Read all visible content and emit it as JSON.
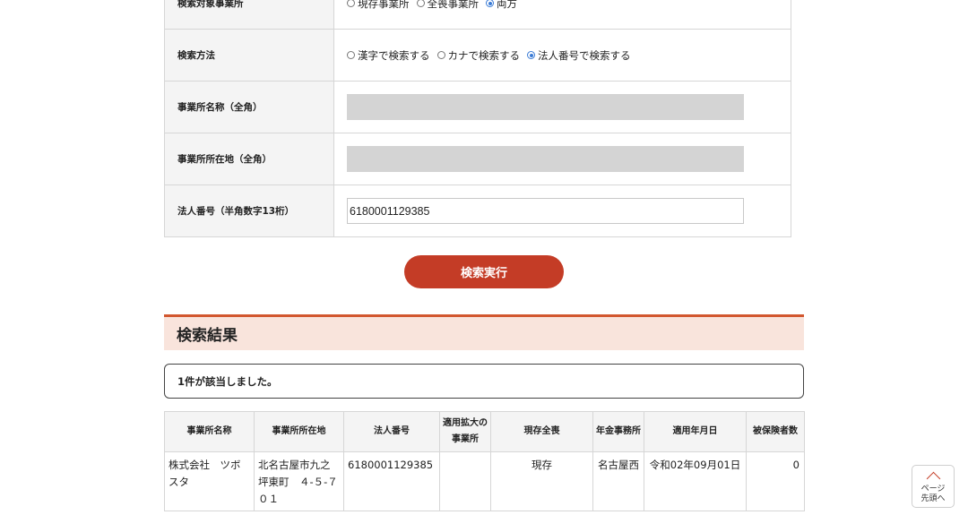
{
  "form": {
    "target": {
      "label": "検索対象事業所",
      "options": [
        "現存事業所",
        "全喪事業所",
        "両方"
      ],
      "selected_index": 2
    },
    "method": {
      "label": "検索方法",
      "options": [
        "漢字で検索する",
        "カナで検索する",
        "法人番号で検索する"
      ],
      "selected_index": 2
    },
    "office_name": {
      "label": "事業所名称（全角）",
      "value": ""
    },
    "office_address": {
      "label": "事業所所在地（全角）",
      "value": ""
    },
    "corporate_number": {
      "label": "法人番号（半角数字13桁）",
      "value": "6180001129385"
    }
  },
  "search_button": {
    "label": "検索実行"
  },
  "results": {
    "heading": "検索結果",
    "count_text": "1件が該当しました。",
    "columns": [
      "事業所名称",
      "事業所所在地",
      "法人番号",
      "適用拡大の事業所",
      "現存全喪",
      "年金事務所",
      "適用年月日",
      "被保険者数"
    ],
    "rows": [
      {
        "name": "株式会社　ツボスタ",
        "address": "北名古屋市九之坪東町　４-５-７０１",
        "corporate_number": "6180001129385",
        "expansion": "",
        "status": "現存",
        "pension_office": "名古屋西",
        "applied_date": "令和02年09月01日",
        "insured_count": "0"
      }
    ]
  },
  "page_top": {
    "label_line1": "ページ",
    "label_line2": "先頭へ"
  },
  "colors": {
    "accent": "#c43c26",
    "heading_bg": "#f9e4dc",
    "heading_border": "#d2572f",
    "radio_checked": "#3a7bd5"
  }
}
